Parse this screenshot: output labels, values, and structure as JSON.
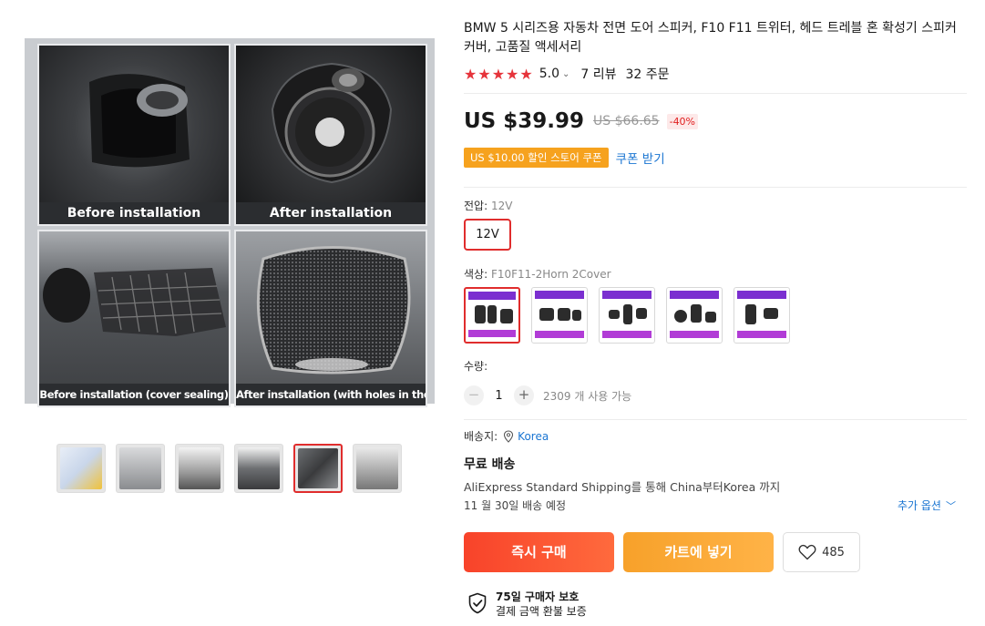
{
  "gallery": {
    "captions": [
      "Before installation",
      "After installation",
      "Before installation (cover sealing)",
      "After installation (with holes in the back)"
    ],
    "thumbnail_count": 6,
    "active_thumbnail": 5
  },
  "product": {
    "title": "BMW 5 시리즈용 자동차 전면 도어 스피커, F10 F11 트위터, 헤드 트레블 혼 확성기 스피커 커버, 고품질 액세서리",
    "rating": "5.0",
    "stars": "★★★★★",
    "reviews": "7 리뷰",
    "orders": "32 주문",
    "price": "US $39.99",
    "original_price": "US $66.65",
    "discount": "-40%",
    "coupon_badge": "US $10.00 할인 스토어 쿠폰",
    "coupon_link": "쿠폰 받기"
  },
  "options": {
    "voltage_label": "전압:",
    "voltage_value": "12V",
    "voltage_button": "12V",
    "color_label": "색상:",
    "color_value": "F10F11-2Horn 2Cover",
    "swatch_count": 5,
    "selected_swatch": 1
  },
  "quantity": {
    "label": "수량:",
    "value": "1",
    "minus": "−",
    "plus": "+",
    "stock": "2309 개 사용 가능"
  },
  "shipping": {
    "ship_to_label": "배송지:",
    "country": "Korea",
    "free_shipping": "무료 배송",
    "description": "AliExpress Standard Shipping를 통해 China부터Korea 까지",
    "delivery_date": "11 월 30일 배송 예정",
    "more_options": "추가 옵션"
  },
  "actions": {
    "buy_now": "즉시 구매",
    "add_to_cart": "카트에 넣기",
    "wishlist_count": "485"
  },
  "protection": {
    "title": "75일 구매자 보호",
    "subtitle": "결제 금액 환불 보증"
  },
  "colors": {
    "accent_red": "#e02d2d",
    "buy_gradient": "#f8432a",
    "cart_gradient": "#f7a12a",
    "link_blue": "#1a75d2",
    "star_red": "#e6343b"
  }
}
